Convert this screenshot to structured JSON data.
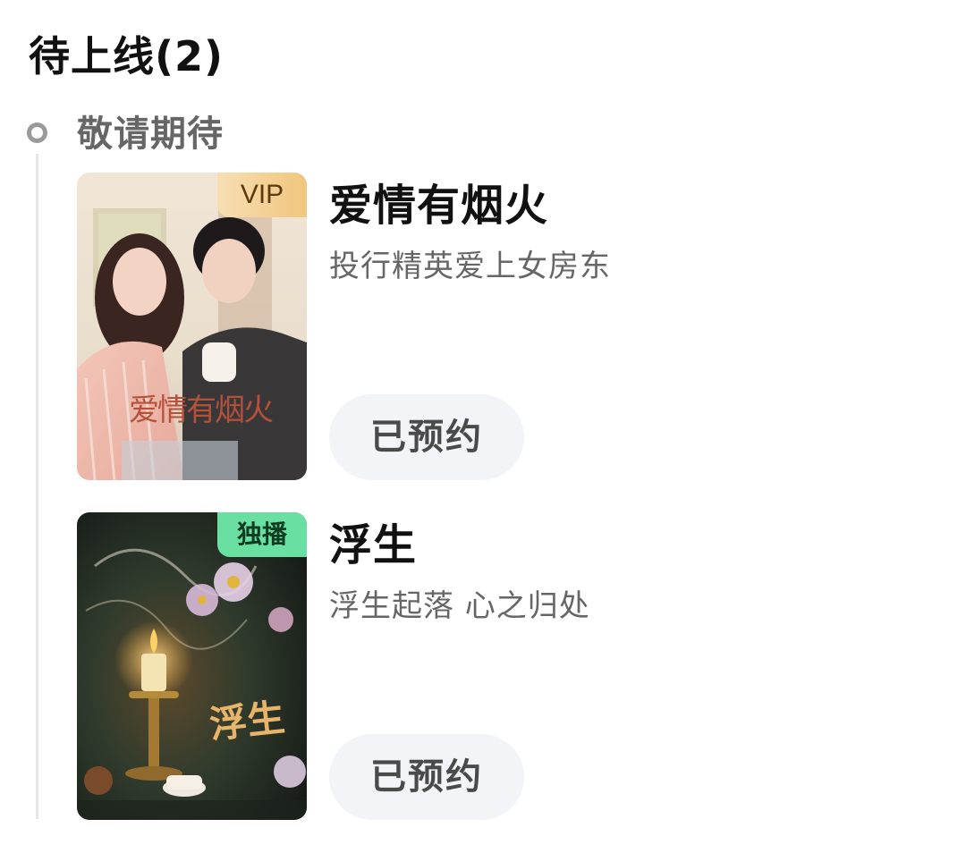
{
  "section": {
    "title": "待上线(2)",
    "group_label": "敬请期待"
  },
  "items": [
    {
      "title": "爱情有烟火",
      "subtitle": "投行精英爱上女房东",
      "badge": "VIP",
      "badge_color": "#f1c57e",
      "poster_text": "爱情有烟火",
      "button_label": "已预约"
    },
    {
      "title": "浮生",
      "subtitle": "浮生起落 心之归处",
      "badge": "独播",
      "badge_color": "#69e0a2",
      "poster_text": "浮生",
      "button_label": "已预约"
    }
  ]
}
